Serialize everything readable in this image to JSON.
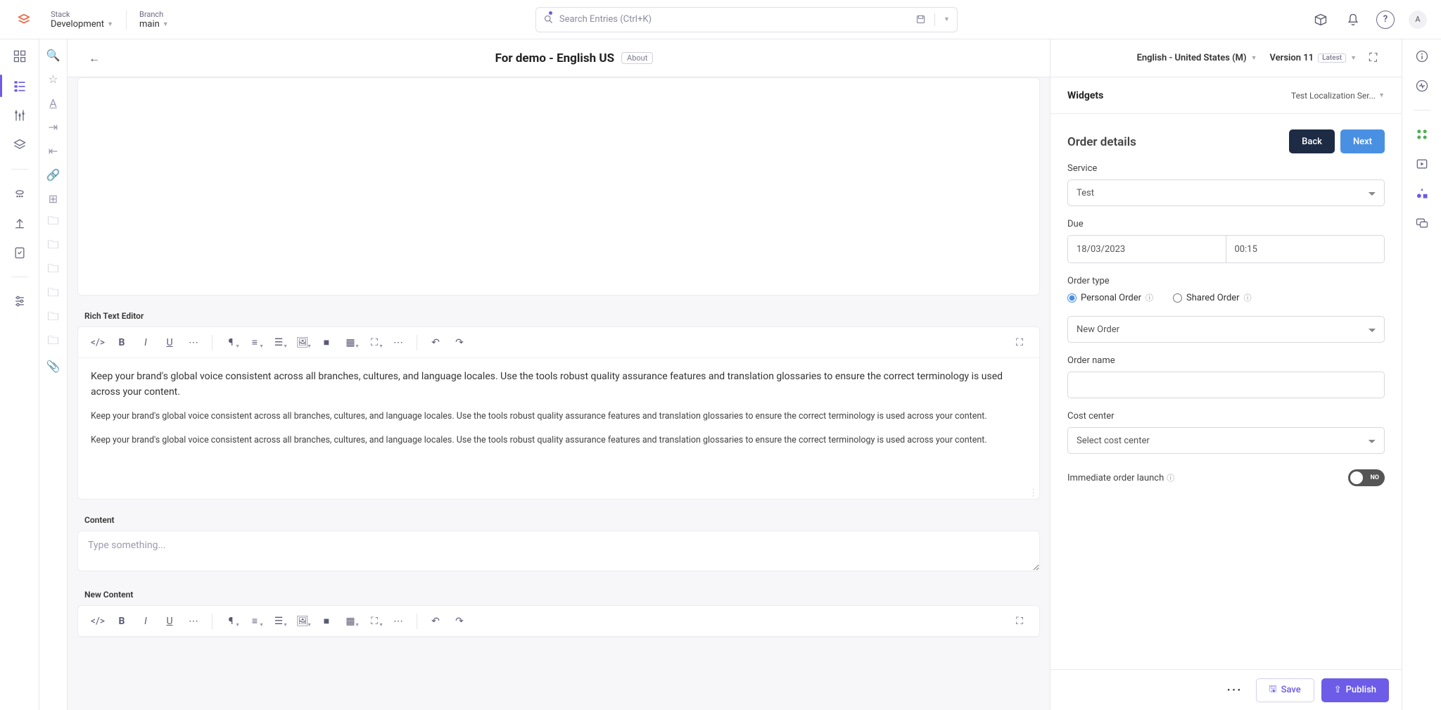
{
  "header": {
    "stack_label": "Stack",
    "stack_value": "Development",
    "branch_label": "Branch",
    "branch_value": "main",
    "search_placeholder": "Search Entries (Ctrl+K)",
    "avatar_initial": "A"
  },
  "subheader": {
    "title": "For demo - English US",
    "badge": "About",
    "language": "English - United States (M)",
    "version": "Version 11",
    "latest_badge": "Latest"
  },
  "editor": {
    "rte_label": "Rich Text Editor",
    "para1": "Keep your brand's global voice consistent across all branches, cultures, and language locales. Use the tools robust quality assurance features and translation glossaries to ensure the correct terminology is used across your content.",
    "para2": "Keep your brand's global voice consistent across all branches, cultures, and language locales. Use the tools robust quality assurance features and translation glossaries to ensure the correct terminology is used across your content.",
    "para3": "Keep your brand's global voice consistent across all branches, cultures, and language locales. Use the tools robust quality assurance features and translation glossaries to ensure the correct terminology is used across your content.",
    "content_label": "Content",
    "content_placeholder": "Type something...",
    "new_content_label": "New Content"
  },
  "widgets": {
    "panel_title": "Widgets",
    "selector": "Test Localization Ser...",
    "back_btn": "Back",
    "next_btn": "Next",
    "section_title": "Order details",
    "service_label": "Service",
    "service_value": "Test",
    "due_label": "Due",
    "due_date": "18/03/2023",
    "due_time": "00:15",
    "order_type_label": "Order type",
    "personal_order": "Personal Order",
    "shared_order": "Shared Order",
    "order_select_value": "New Order",
    "order_name_label": "Order name",
    "order_name_value": "",
    "cost_center_label": "Cost center",
    "cost_center_value": "Select cost center",
    "imm_launch_label": "Immediate order launch",
    "imm_launch_value": "NO"
  },
  "footer": {
    "save": "Save",
    "publish": "Publish"
  }
}
